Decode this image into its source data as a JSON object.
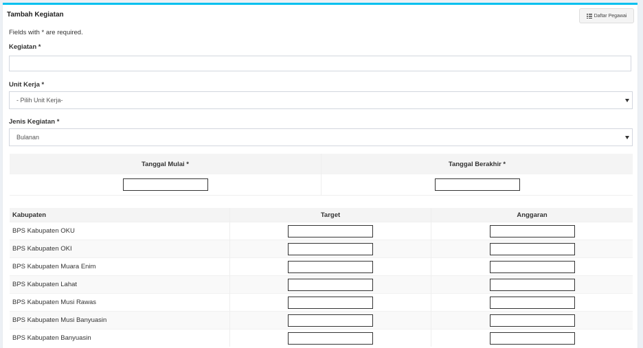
{
  "box": {
    "title": "Tambah Kegiatan",
    "daftar_button": "Daftar Pegawai",
    "required_note": "Fields with * are required."
  },
  "form": {
    "kegiatan_label": "Kegiatan *",
    "kegiatan_value": "",
    "unit_kerja_label": "Unit Kerja *",
    "unit_kerja_selected": "- Pilih Unit Kerja-",
    "jenis_label": "Jenis Kegiatan *",
    "jenis_selected": "Bulanan",
    "tanggal_mulai_label": "Tanggal Mulai *",
    "tanggal_berakhir_label": "Tanggal Berakhir *"
  },
  "table": {
    "headers": [
      "Kabupaten",
      "Target",
      "Anggaran"
    ],
    "rows": [
      "BPS Kabupaten OKU",
      "BPS Kabupaten OKI",
      "BPS Kabupaten Muara Enim",
      "BPS Kabupaten Lahat",
      "BPS Kabupaten Musi Rawas",
      "BPS Kabupaten Musi Banyuasin",
      "BPS Kabupaten Banyuasin"
    ]
  },
  "colors": {
    "accent": "#00c0ef",
    "background": "#ecf0f5",
    "table_head": "#f4f4f4"
  }
}
